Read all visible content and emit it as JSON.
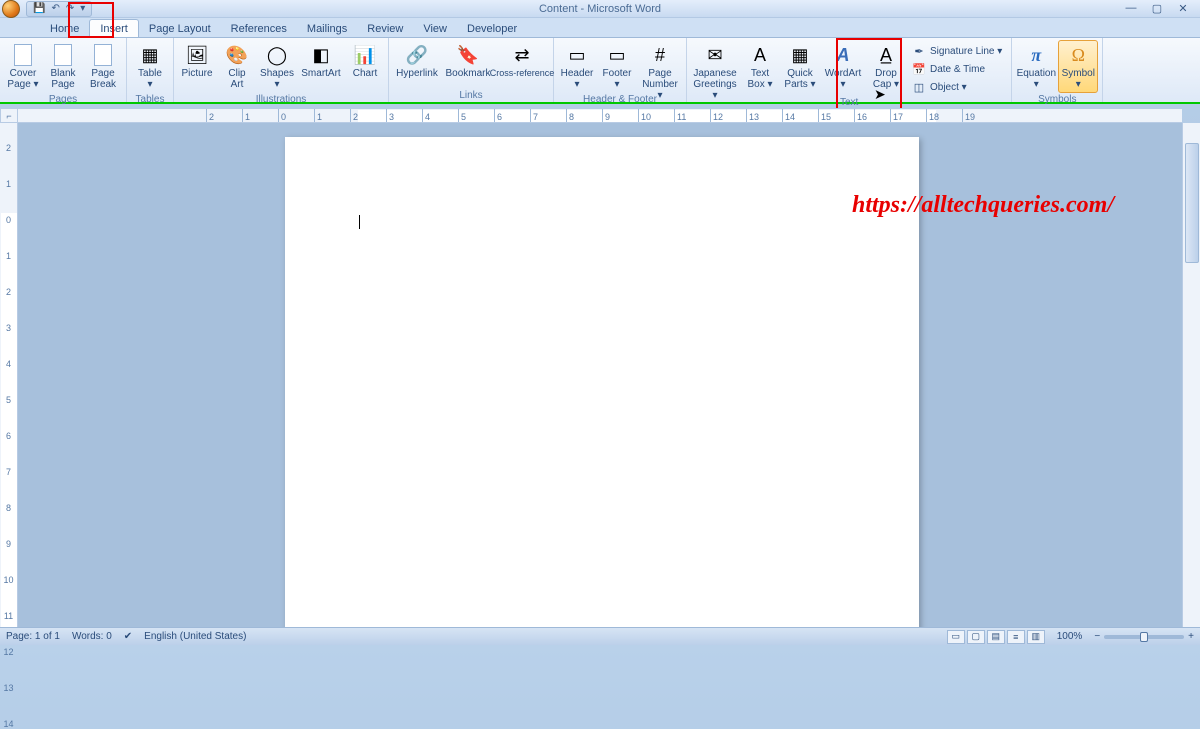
{
  "app": {
    "title": "Content - Microsoft Word",
    "qat": {
      "save": "💾",
      "undo": "↶",
      "redo": "↷",
      "dropdown": "▾"
    },
    "win": {
      "min": "—",
      "max": "▢",
      "close": "✕"
    }
  },
  "tabs": [
    "Home",
    "Insert",
    "Page Layout",
    "References",
    "Mailings",
    "Review",
    "View",
    "Developer"
  ],
  "active_tab_index": 1,
  "ribbon": {
    "pages": {
      "label": "Pages",
      "cover": "Cover\nPage ▾",
      "blank": "Blank\nPage",
      "break": "Page\nBreak"
    },
    "tables": {
      "label": "Tables",
      "table": "Table\n▾"
    },
    "illustrations": {
      "label": "Illustrations",
      "picture": "Picture",
      "clipart": "Clip\nArt",
      "shapes": "Shapes\n▾",
      "smartart": "SmartArt",
      "chart": "Chart"
    },
    "links": {
      "label": "Links",
      "hyperlink": "Hyperlink",
      "bookmark": "Bookmark",
      "crossref": "Cross-reference"
    },
    "header_footer": {
      "label": "Header & Footer",
      "header": "Header\n▾",
      "footer": "Footer\n▾",
      "pagenum": "Page\nNumber ▾"
    },
    "text": {
      "label": "Text",
      "greetings": "Japanese\nGreetings ▾",
      "textbox": "Text\nBox ▾",
      "quickparts": "Quick\nParts ▾",
      "wordart": "WordArt\n▾",
      "dropcap": "Drop\nCap ▾",
      "sigline": "Signature Line ▾",
      "datetime": "Date & Time",
      "object": "Object ▾"
    },
    "symbols": {
      "label": "Symbols",
      "equation": "Equation\n▾",
      "symbol": "Symbol\n▾"
    }
  },
  "ruler_h": {
    "start": -2,
    "end": 19
  },
  "ruler_v": {
    "start": -2,
    "end": 14
  },
  "statusbar": {
    "page": "Page: 1 of 1",
    "words": "Words: 0",
    "lang": "English (United States)",
    "zoom": "100%"
  },
  "watermark": "https://alltechqueries.com/"
}
